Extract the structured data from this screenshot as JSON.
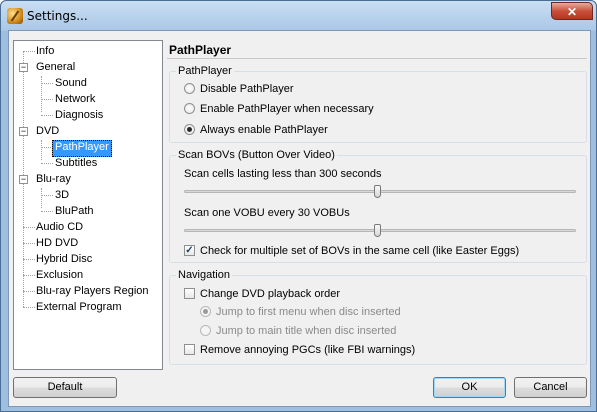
{
  "window": {
    "title": "Settings...",
    "close_label": "✕"
  },
  "tree": {
    "items": [
      {
        "label": "Info"
      },
      {
        "label": "General",
        "expander": "−"
      },
      {
        "label": "Sound"
      },
      {
        "label": "Network"
      },
      {
        "label": "Diagnosis"
      },
      {
        "label": "DVD",
        "expander": "−"
      },
      {
        "label": "PathPlayer",
        "selected": true
      },
      {
        "label": "Subtitles"
      },
      {
        "label": "Blu-ray",
        "expander": "−"
      },
      {
        "label": "3D"
      },
      {
        "label": "BluPath"
      },
      {
        "label": "Audio CD"
      },
      {
        "label": "HD DVD"
      },
      {
        "label": "Hybrid Disc"
      },
      {
        "label": "Exclusion"
      },
      {
        "label": "Blu-ray Players Region"
      },
      {
        "label": "External Program"
      }
    ]
  },
  "panel": {
    "title": "PathPlayer",
    "pathplayer_group": {
      "title": "PathPlayer",
      "options": [
        {
          "label": "Disable PathPlayer",
          "checked": false
        },
        {
          "label": "Enable PathPlayer when necessary",
          "checked": false
        },
        {
          "label": "Always enable PathPlayer",
          "checked": true
        }
      ]
    },
    "bov_group": {
      "title": "Scan BOVs (Button Over Video)",
      "slider1_label": "Scan cells lasting less than 300 seconds",
      "slider1_level": 0.49,
      "slider2_label": "Scan one VOBU every 30 VOBUs",
      "slider2_level": 0.49,
      "check_label": "Check for multiple set of BOVs in the same cell (like Easter Eggs)",
      "check_checked": true,
      "check_mark": "✓"
    },
    "nav_group": {
      "title": "Navigation",
      "change_label": "Change DVD playback order",
      "change_checked": false,
      "jump_first_label": "Jump to first menu when disc inserted",
      "jump_first_checked": true,
      "jump_main_label": "Jump to main title when disc inserted",
      "jump_main_checked": false,
      "remove_label": "Remove annoying PGCs (like FBI warnings)",
      "remove_checked": false
    }
  },
  "buttons": {
    "default_label": "Default",
    "ok_label": "OK",
    "cancel_label": "Cancel"
  }
}
